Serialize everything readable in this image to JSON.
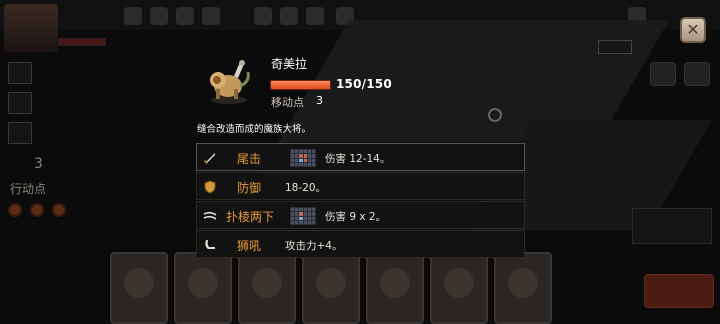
{
  "unit": {
    "name": "奇美拉",
    "hp_text": "150/150",
    "hp_fraction": 1.0,
    "move_label": "移动点",
    "move_value": "3",
    "description": "缝合改造而成的魔族大将。"
  },
  "skills": [
    {
      "icon": "sword-icon",
      "name": "尾击",
      "has_range": true,
      "effect": "伤害 12-14。"
    },
    {
      "icon": "shield-icon",
      "name": "防御",
      "has_range": false,
      "effect": "18-20。"
    },
    {
      "icon": "claw-icon",
      "name": "扑棱两下",
      "has_range": true,
      "effect": "伤害 9 x 2。"
    },
    {
      "icon": "roar-icon",
      "name": "狮吼",
      "has_range": false,
      "effect": "攻击力+4。"
    }
  ],
  "background": {
    "action_points_value": "3",
    "action_points_label": "行动点"
  },
  "colors": {
    "skill_name": "#e89a3a",
    "hp_fill": "#e24a1e",
    "close_button": "#cdb9a3"
  }
}
